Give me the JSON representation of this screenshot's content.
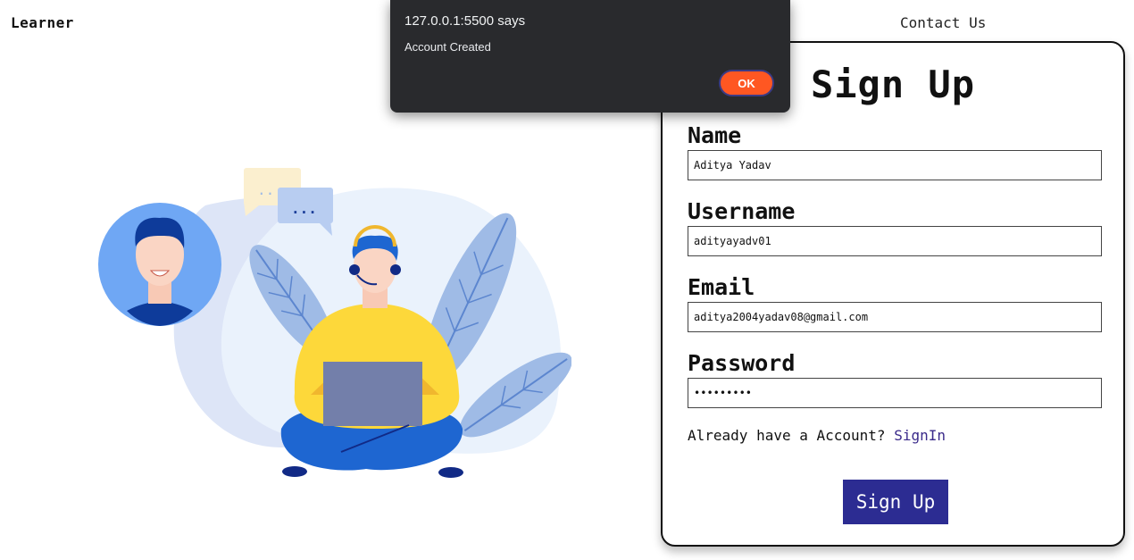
{
  "header": {
    "brand": "Learner",
    "contact_label": "Contact Us"
  },
  "signup": {
    "title": "Sign Up",
    "fields": [
      {
        "label": "Name",
        "value": "Aditya Yadav",
        "type": "text"
      },
      {
        "label": "Username",
        "value": "adityayadv01",
        "type": "text"
      },
      {
        "label": "Email",
        "value": "aditya2004yadav08@gmail.com",
        "type": "email"
      },
      {
        "label": "Password",
        "value": "aditya123",
        "type": "password"
      }
    ],
    "signin_prompt": "Already have a Account?",
    "signin_link": "SignIn",
    "submit_label": "Sign Up"
  },
  "dialog": {
    "origin": "127.0.0.1:5500 says",
    "message": "Account Created",
    "ok_label": "OK"
  },
  "illustration": {
    "icon": "support-agent-illustration",
    "chat_dots": "..."
  },
  "colors": {
    "dialog_bg": "#292a2d",
    "ok_button": "#ff5722",
    "submit_button": "#2c2c92",
    "link": "#3a2a8a"
  }
}
